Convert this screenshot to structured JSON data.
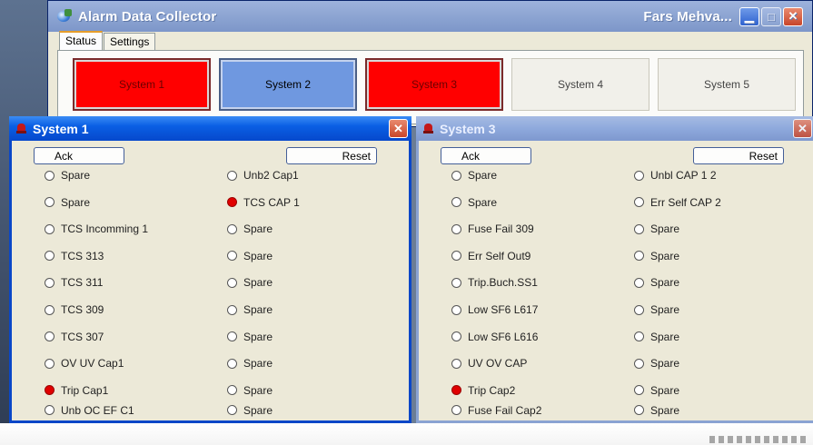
{
  "main": {
    "title": "Alarm Data Collector",
    "user": "Fars Mehva...",
    "tabs": [
      {
        "label": "Status",
        "active": true
      },
      {
        "label": "Settings",
        "active": false
      }
    ],
    "systems": [
      {
        "label": "System 1",
        "state": "alarm",
        "color": "#ff0000"
      },
      {
        "label": "System 2",
        "state": "selected",
        "color": "#6f98e0"
      },
      {
        "label": "System 3",
        "state": "alarm",
        "color": "#ff0000"
      },
      {
        "label": "System 4",
        "state": "normal",
        "color": "#f1f0ea"
      },
      {
        "label": "System 5",
        "state": "normal",
        "color": "#f1f0ea"
      }
    ]
  },
  "windows": [
    {
      "title": "System 1",
      "ack": "Ack",
      "reset": "Reset",
      "left": [
        {
          "label": "Spare",
          "on": false
        },
        {
          "label": "Spare",
          "on": false
        },
        {
          "label": "TCS Incomming 1",
          "on": false
        },
        {
          "label": "TCS 313",
          "on": false
        },
        {
          "label": "TCS 311",
          "on": false
        },
        {
          "label": "TCS 309",
          "on": false
        },
        {
          "label": "TCS 307",
          "on": false
        },
        {
          "label": "OV  UV Cap1",
          "on": false
        },
        {
          "label": "Trip Cap1",
          "on": true
        },
        {
          "label": "Unb  OC  EF C1",
          "on": false
        }
      ],
      "right": [
        {
          "label": "Unb2 Cap1",
          "on": false
        },
        {
          "label": "TCS CAP 1",
          "on": true
        },
        {
          "label": "Spare",
          "on": false
        },
        {
          "label": "Spare",
          "on": false
        },
        {
          "label": "Spare",
          "on": false
        },
        {
          "label": "Spare",
          "on": false
        },
        {
          "label": "Spare",
          "on": false
        },
        {
          "label": "Spare",
          "on": false
        },
        {
          "label": "Spare",
          "on": false
        },
        {
          "label": "Spare",
          "on": false
        }
      ]
    },
    {
      "title": "System 3",
      "ack": "Ack",
      "reset": "Reset",
      "left": [
        {
          "label": "Spare",
          "on": false
        },
        {
          "label": "Spare",
          "on": false
        },
        {
          "label": "Fuse Fail 309",
          "on": false
        },
        {
          "label": "Err Self Out9",
          "on": false
        },
        {
          "label": "Trip.Buch.SS1",
          "on": false
        },
        {
          "label": "Low SF6 L617",
          "on": false
        },
        {
          "label": "Low SF6 L616",
          "on": false
        },
        {
          "label": "UV  OV CAP",
          "on": false
        },
        {
          "label": "Trip Cap2",
          "on": true
        },
        {
          "label": "Fuse Fail Cap2",
          "on": false
        }
      ],
      "right": [
        {
          "label": "Unbl CAP 1  2",
          "on": false
        },
        {
          "label": "Err Self CAP 2",
          "on": false
        },
        {
          "label": "Spare",
          "on": false
        },
        {
          "label": "Spare",
          "on": false
        },
        {
          "label": "Spare",
          "on": false
        },
        {
          "label": "Spare",
          "on": false
        },
        {
          "label": "Spare",
          "on": false
        },
        {
          "label": "Spare",
          "on": false
        },
        {
          "label": "Spare",
          "on": false
        },
        {
          "label": "Spare",
          "on": false
        }
      ]
    }
  ]
}
